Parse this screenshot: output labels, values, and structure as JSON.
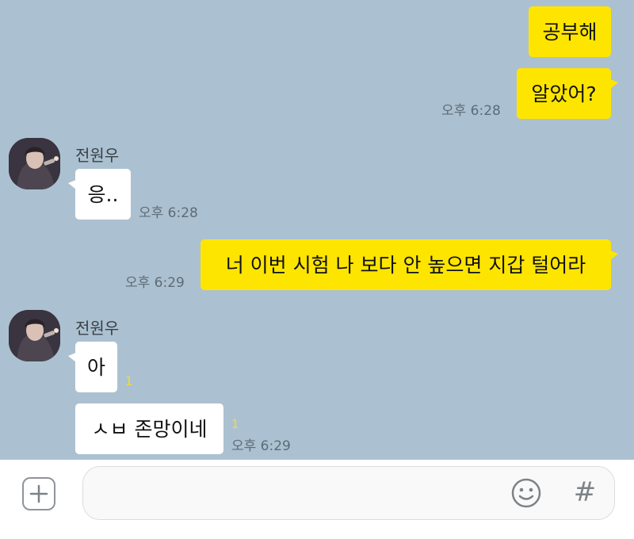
{
  "colors": {
    "background": "#abc1d1",
    "my_bubble": "#fee500",
    "other_bubble": "#ffffff",
    "unread_count": "#f5dd2a"
  },
  "messages": [
    {
      "from": "me",
      "text": "공부해"
    },
    {
      "from": "me",
      "text": "알았어?",
      "time": "오후 6:28"
    },
    {
      "from": "other",
      "sender": "전원우",
      "text": "응..",
      "time": "오후 6:28"
    },
    {
      "from": "me",
      "text": "너 이번 시험 나 보다 안 높으면 지갑 털어라",
      "time": "오후 6:29"
    },
    {
      "from": "other",
      "sender": "전원우",
      "text": "아",
      "unread": "1"
    },
    {
      "from": "other",
      "text": "ㅅㅂ 존망이네",
      "unread": "1",
      "time": "오후 6:29"
    }
  ],
  "composer": {
    "placeholder": "",
    "icons": [
      "plus-icon",
      "emoji-icon",
      "hashtag-icon"
    ],
    "hash_glyph": "#"
  }
}
